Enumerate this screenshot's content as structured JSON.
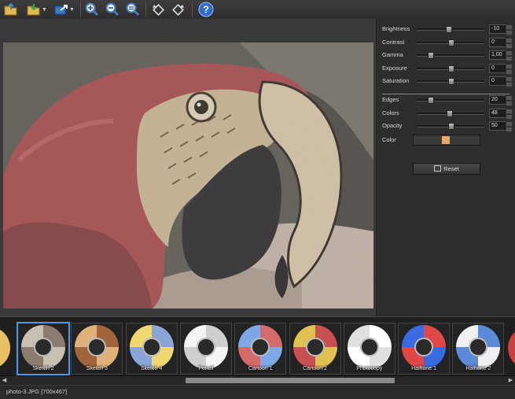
{
  "toolbar": {
    "icons": [
      "open-folder-icon",
      "save-folder-icon",
      "share-export-icon",
      "zoom-in-icon",
      "zoom-out-icon",
      "zoom-fit-icon",
      "rotate-left-icon",
      "rotate-right-icon",
      "help-icon"
    ],
    "help_label": "?"
  },
  "adjustments": [
    {
      "label": "Brightness",
      "value": "-10",
      "level": 0.47
    },
    {
      "label": "Contrast",
      "value": "0",
      "level": 0.5
    },
    {
      "label": "Gamma",
      "value": "1,00",
      "level": 0.2
    },
    {
      "label": "Exposure",
      "value": "0",
      "level": 0.5
    },
    {
      "label": "Saturation",
      "value": "0",
      "level": 0.5
    }
  ],
  "effect": [
    {
      "label": "Edges",
      "value": "20",
      "level": 0.2
    },
    {
      "label": "Colors",
      "value": "48",
      "level": 0.48
    },
    {
      "label": "Opacity",
      "value": "50",
      "level": 0.5
    }
  ],
  "color": {
    "label": "Color",
    "swatch": "#e8a96a"
  },
  "reset_label": "Reset",
  "presets": [
    {
      "name": "Sketch 2",
      "selected": true,
      "c1": "#8a7d70",
      "c2": "#c9c0b4"
    },
    {
      "name": "Sketch 3",
      "selected": false,
      "c1": "#a2643a",
      "c2": "#e0b27a"
    },
    {
      "name": "Sketch 4",
      "selected": false,
      "c1": "#8aa6d8",
      "c2": "#f0d870"
    },
    {
      "name": "Pencil",
      "selected": false,
      "c1": "#cfcfcf",
      "c2": "#f4f4f4"
    },
    {
      "name": "Cartoon 1",
      "selected": false,
      "c1": "#d46a6a",
      "c2": "#7fa8e8"
    },
    {
      "name": "Cartoon 2",
      "selected": false,
      "c1": "#c85050",
      "c2": "#e0c050"
    },
    {
      "name": "Photocopy",
      "selected": false,
      "c1": "#ffffff",
      "c2": "#e0e0e0"
    },
    {
      "name": "Halftone 1",
      "selected": false,
      "c1": "#e04848",
      "c2": "#3a6ae0"
    },
    {
      "name": "Halftone 2",
      "selected": false,
      "c1": "#5a8ad8",
      "c2": "#f0f0f0"
    }
  ],
  "status": "photo-3.JPG [700x467]"
}
